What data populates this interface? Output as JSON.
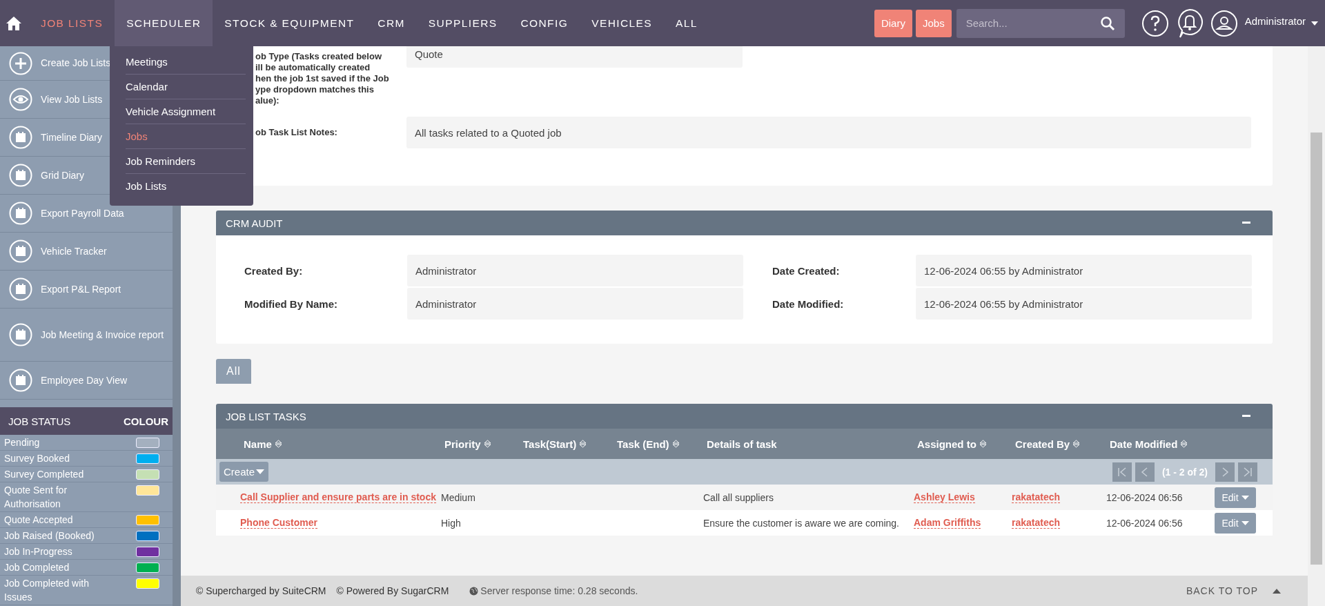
{
  "nav": {
    "items": [
      {
        "label": "JOB LISTS",
        "selected": true,
        "expanded": false
      },
      {
        "label": "SCHEDULER",
        "selected": false,
        "expanded": true
      },
      {
        "label": "STOCK & EQUIPMENT",
        "selected": false,
        "expanded": false
      },
      {
        "label": "CRM",
        "selected": false,
        "expanded": false
      },
      {
        "label": "SUPPLIERS",
        "selected": false,
        "expanded": false
      },
      {
        "label": "CONFIG",
        "selected": false,
        "expanded": false
      },
      {
        "label": "VEHICLES",
        "selected": false,
        "expanded": false
      },
      {
        "label": "ALL",
        "selected": false,
        "expanded": false
      }
    ],
    "dropdown": [
      {
        "label": "Meetings",
        "selected": false
      },
      {
        "label": "Calendar",
        "selected": false
      },
      {
        "label": "Vehicle Assignment",
        "selected": false
      },
      {
        "label": "Jobs",
        "selected": true
      },
      {
        "label": "Job Reminders",
        "selected": false
      },
      {
        "label": "Job Lists",
        "selected": false
      }
    ],
    "buttons": [
      "Diary",
      "Jobs"
    ],
    "search": {
      "placeholder": "Search..."
    },
    "user": "Administrator"
  },
  "sidebar": {
    "actions": [
      {
        "label": "Create Job Lists",
        "kind": "create"
      },
      {
        "label": "View Job Lists",
        "kind": "view"
      },
      {
        "label": "Timeline Diary",
        "kind": "report"
      },
      {
        "label": "Grid Diary",
        "kind": "report"
      },
      {
        "label": "Export Payroll Data",
        "kind": "report"
      },
      {
        "label": "Vehicle Tracker",
        "kind": "report"
      },
      {
        "label": "Export P&L Report",
        "kind": "report"
      },
      {
        "label": "Job Meeting & Invoice report",
        "kind": "report"
      },
      {
        "label": "Employee Day View",
        "kind": "report"
      }
    ],
    "status_header": [
      "JOB STATUS",
      "COLOUR"
    ],
    "statuses": [
      {
        "label": "Pending",
        "color": "#a4b0bf"
      },
      {
        "label": "Survey Booked",
        "color": "#00aeef"
      },
      {
        "label": "Survey Completed",
        "color": "#c5e0b4"
      },
      {
        "label": "Quote Sent for Authorisation",
        "color": "#ffe699"
      },
      {
        "label": "Quote Accepted",
        "color": "#ffc000"
      },
      {
        "label": "Job Raised (Booked)",
        "color": "#0070c0"
      },
      {
        "label": "Job In-Progress",
        "color": "#7030a0"
      },
      {
        "label": "Job Completed",
        "color": "#00b050"
      },
      {
        "label": "Job Completed with Issues",
        "color": "#ffff00"
      }
    ]
  },
  "details": {
    "fields": [
      {
        "label_lines": [
          "ob Type (Tasks created below",
          "ill be automatically created",
          "hen the job 1st saved if the Job",
          "ype dropdown matches this",
          "alue):"
        ],
        "value": "Quote"
      },
      {
        "label_lines": [
          "ob Task List Notes:"
        ],
        "value": "All tasks related to a Quoted job"
      }
    ]
  },
  "crm_audit": {
    "title": "CRM AUDIT",
    "fields": [
      {
        "label": "Created By:",
        "value": "Administrator"
      },
      {
        "label": "Date Created:",
        "value": "12-06-2024 06:55 by Administrator"
      },
      {
        "label": "Modified By Name:",
        "value": "Administrator"
      },
      {
        "label": "Date Modified:",
        "value": "12-06-2024 06:55 by Administrator"
      }
    ]
  },
  "tabs": [
    {
      "label": "All",
      "selected": true
    }
  ],
  "tasks": {
    "title": "JOB LIST TASKS",
    "columns": [
      {
        "label": "Name",
        "sortable": true
      },
      {
        "label": "Priority",
        "sortable": true
      },
      {
        "label": "Task(Start)",
        "sortable": true
      },
      {
        "label": "Task (End)",
        "sortable": true
      },
      {
        "label": "Details of task",
        "sortable": false
      },
      {
        "label": "Assigned to",
        "sortable": true
      },
      {
        "label": "Created By",
        "sortable": true
      },
      {
        "label": "Date Modified",
        "sortable": true
      }
    ],
    "create": "Create",
    "pagination": "(1 - 2 of 2)",
    "rows": [
      {
        "name": "Call Supplier and ensure parts are in stock",
        "priority": "Medium",
        "details": "Call all suppliers",
        "assigned": "Ashley Lewis",
        "created_by": "rakatatech",
        "modified": "12-06-2024 06:56",
        "action": "Edit"
      },
      {
        "name": "Phone Customer",
        "priority": "High",
        "details": "Ensure the customer is aware we are coming.",
        "assigned": "Adam Griffiths",
        "created_by": "rakatatech",
        "modified": "12-06-2024 06:56",
        "action": "Edit"
      }
    ]
  },
  "footer": {
    "credits": [
      "© Supercharged by SuiteCRM",
      "© Powered By SugarCRM"
    ],
    "response": "Server response time: 0.28 seconds.",
    "back_to_top": "BACK TO TOP"
  }
}
